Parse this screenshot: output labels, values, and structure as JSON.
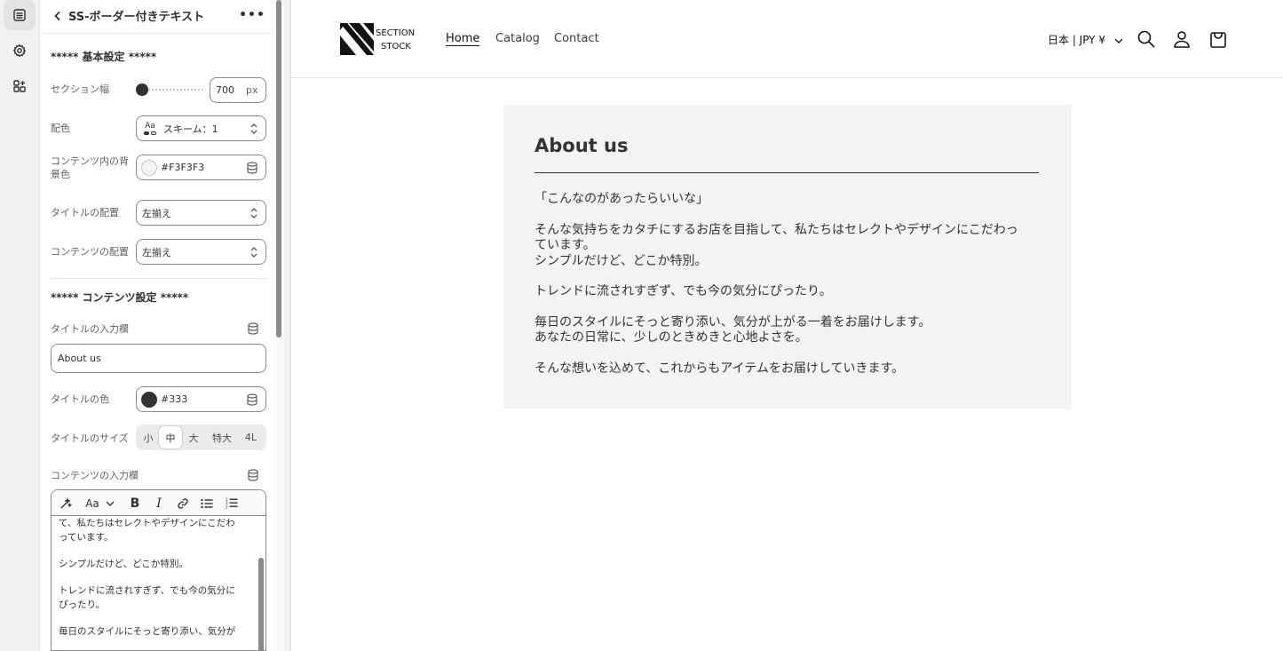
{
  "rail": {
    "items": [
      {
        "icon": "sections-icon",
        "active": true
      },
      {
        "icon": "gear-icon",
        "active": false
      },
      {
        "icon": "apps-icon",
        "active": false
      }
    ]
  },
  "panel": {
    "title": "SS-ボーダー付きテキスト",
    "basic_heading": "***** 基本設定 *****",
    "section_width_label": "セクション幅",
    "section_width_value": "700",
    "section_width_unit": "px",
    "section_width_level": 0,
    "color_label": "配色",
    "color_scheme_value": "スキーム：1",
    "bg_label": "コンテンツ内の背景色",
    "bg_value": "#F3F3F3",
    "title_align_label": "タイトルの配置",
    "title_align_value": "左揃え",
    "content_align_label": "コンテンツの配置",
    "content_align_value": "左揃え",
    "content_heading": "***** コンテンツ設定 *****",
    "title_input_label": "タイトルの入力欄",
    "title_input_value": "About us",
    "title_color_label": "タイトルの色",
    "title_color_value": "#333",
    "title_size_label": "タイトルのサイズ",
    "title_size_options": [
      "小",
      "中",
      "大",
      "特大",
      "4L"
    ],
    "title_size_selected": "中",
    "content_input_label": "コンテンツの入力欄",
    "rte_font_label": "Aa",
    "rte_lines": [
      "て、私たちはセレクトやデザインにこだわ",
      "っています。",
      "",
      "シンプルだけど、どこか特別。",
      "",
      "トレンドに流されすぎず、でも今の気分に",
      "ぴったり。",
      "",
      "毎日のスタイルにそっと寄り添い、気分が"
    ]
  },
  "store": {
    "logo_line1": "SECTION",
    "logo_line2": "STOCK",
    "nav": [
      "Home",
      "Catalog",
      "Contact"
    ],
    "nav_active": "Home",
    "locale": "日本 | JPY ¥",
    "card_title": "About us",
    "card_paragraphs": [
      [
        "「こんなのがあったらいいな」"
      ],
      [
        "そんな気持ちをカタチにするお店を目指して、私たちはセレクトやデザインにこだわっ",
        "ています。",
        "シンプルだけど、どこか特別。"
      ],
      [
        "トレンドに流されすぎず、でも今の気分にぴったり。"
      ],
      [
        "毎日のスタイルにそっと寄り添い、気分が上がる一着をお届けします。",
        "あなたの日常に、少しのときめきと心地よさを。"
      ],
      [
        "そんな想いを込めて、これからもアイテムをお届けしていきます。"
      ]
    ]
  },
  "colors": {
    "card_bg": "#F3F3F3",
    "title_color": "#333333",
    "accent_dark": "#303030"
  }
}
